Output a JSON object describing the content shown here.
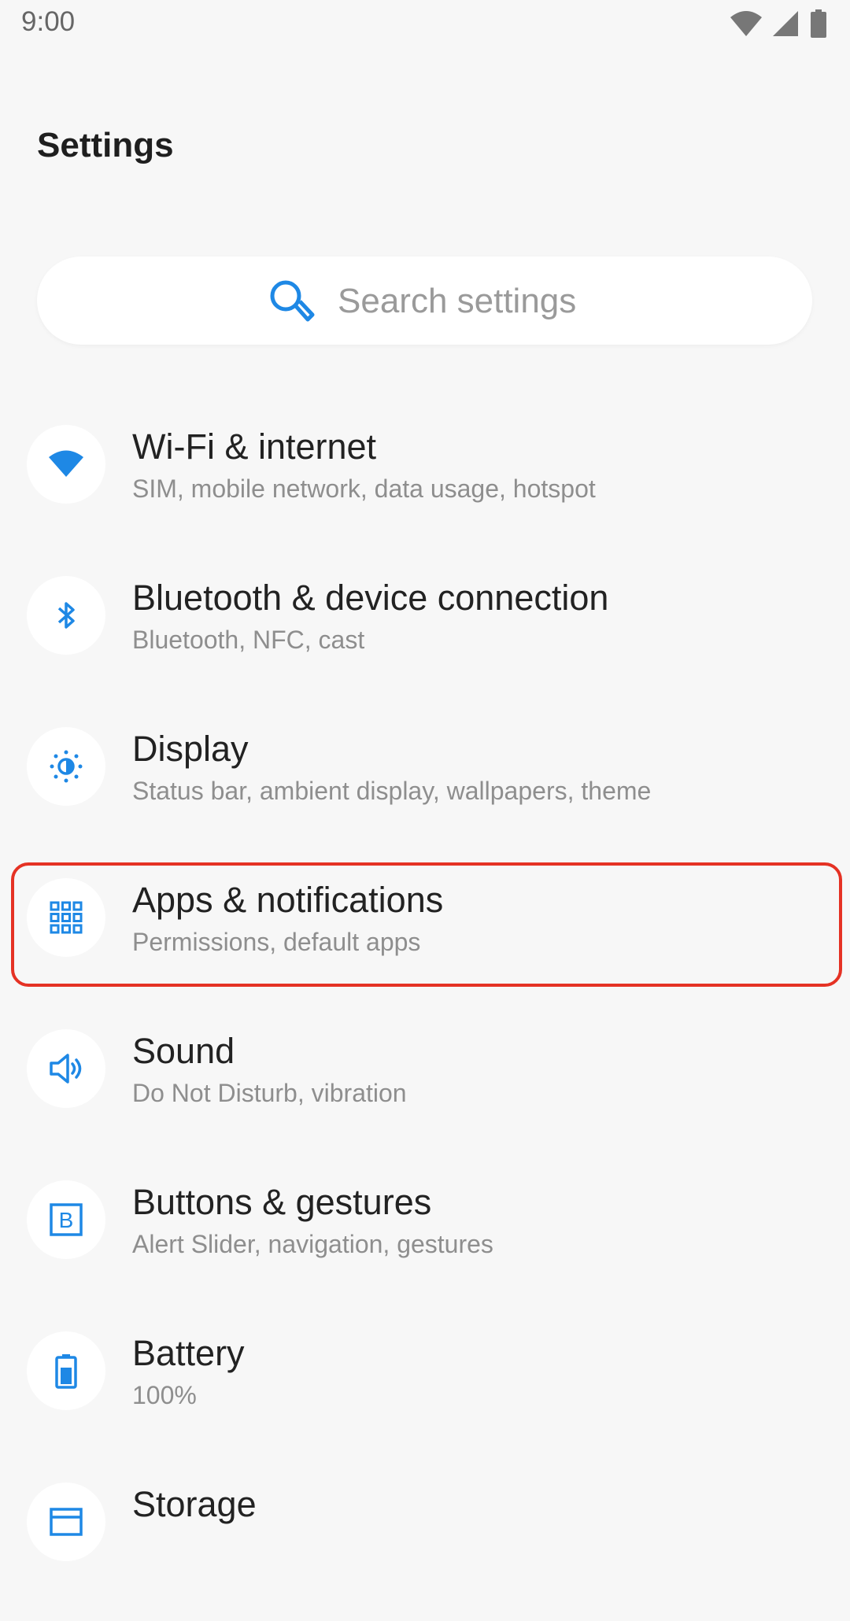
{
  "status_bar": {
    "time": "9:00",
    "icons": [
      "wifi-icon",
      "cell-signal-icon",
      "battery-icon"
    ]
  },
  "page": {
    "title": "Settings"
  },
  "search": {
    "placeholder": "Search settings"
  },
  "colors": {
    "accent": "#1e88e5",
    "highlight_border": "#e53224",
    "background": "#f7f7f7"
  },
  "items": [
    {
      "icon": "wifi-icon",
      "title": "Wi-Fi & internet",
      "subtitle": "SIM, mobile network, data usage, hotspot"
    },
    {
      "icon": "bluetooth-icon",
      "title": "Bluetooth & device connection",
      "subtitle": "Bluetooth, NFC, cast"
    },
    {
      "icon": "brightness-icon",
      "title": "Display",
      "subtitle": "Status bar, ambient display, wallpapers, theme"
    },
    {
      "icon": "apps-grid-icon",
      "title": "Apps & notifications",
      "subtitle": "Permissions, default apps"
    },
    {
      "icon": "volume-icon",
      "title": "Sound",
      "subtitle": "Do Not Disturb, vibration"
    },
    {
      "icon": "buttons-icon",
      "title": "Buttons & gestures",
      "subtitle": "Alert Slider, navigation, gestures"
    },
    {
      "icon": "battery-icon",
      "title": "Battery",
      "subtitle": "100%"
    },
    {
      "icon": "storage-icon",
      "title": "Storage",
      "subtitle": ""
    }
  ]
}
